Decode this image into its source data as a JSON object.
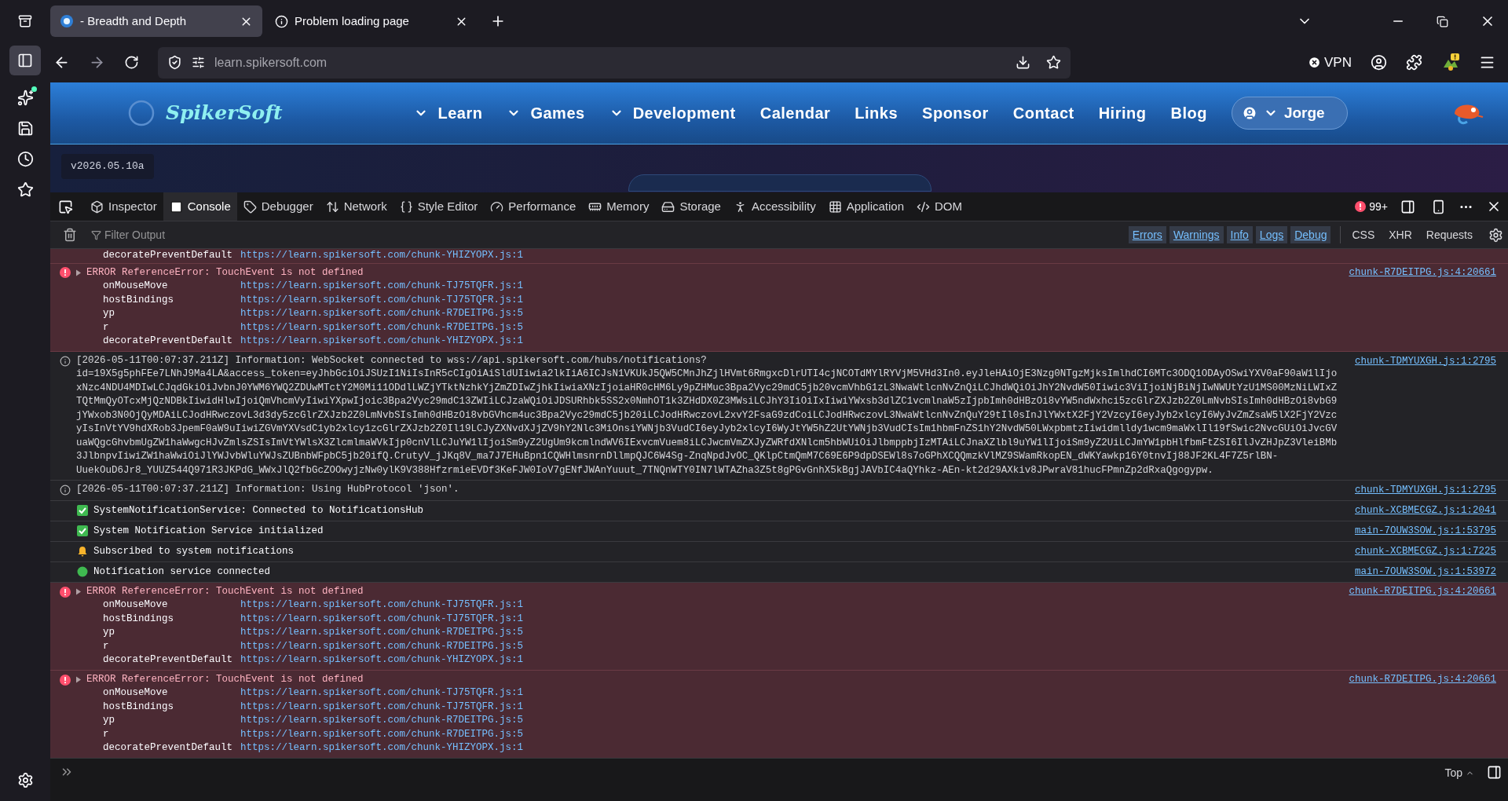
{
  "browser": {
    "tabs": [
      {
        "title": "- Breadth and Depth",
        "selected": true,
        "kind": "site"
      },
      {
        "title": "Problem loading page",
        "selected": false,
        "kind": "info"
      }
    ],
    "url_prefix": "learn.",
    "url_domain": "spikersoft.com",
    "vpn": "VPN"
  },
  "site": {
    "logo": "SpikerSoft",
    "nav": [
      {
        "label": "Learn",
        "dropdown": true
      },
      {
        "label": "Games",
        "dropdown": true
      },
      {
        "label": "Development",
        "dropdown": true
      },
      {
        "label": "Calendar",
        "dropdown": false
      },
      {
        "label": "Links",
        "dropdown": false
      },
      {
        "label": "Sponsor",
        "dropdown": false
      },
      {
        "label": "Contact",
        "dropdown": false
      },
      {
        "label": "Hiring",
        "dropdown": false
      },
      {
        "label": "Blog",
        "dropdown": false
      }
    ],
    "user": "Jorge",
    "version": "v2026.05.10a"
  },
  "devtools": {
    "tabs": [
      {
        "label": "Inspector",
        "selected": false
      },
      {
        "label": "Console",
        "selected": true
      },
      {
        "label": "Debugger",
        "selected": false
      },
      {
        "label": "Network",
        "selected": false
      },
      {
        "label": "Style Editor",
        "selected": false
      },
      {
        "label": "Performance",
        "selected": false
      },
      {
        "label": "Memory",
        "selected": false
      },
      {
        "label": "Storage",
        "selected": false
      },
      {
        "label": "Accessibility",
        "selected": false
      },
      {
        "label": "Application",
        "selected": false
      },
      {
        "label": "DOM",
        "selected": false
      }
    ],
    "error_count": "99+",
    "filter_placeholder": "Filter Output",
    "levels": [
      {
        "label": "Errors",
        "selected": true
      },
      {
        "label": "Warnings",
        "selected": true
      },
      {
        "label": "Info",
        "selected": true
      },
      {
        "label": "Logs",
        "selected": true
      },
      {
        "label": "Debug",
        "selected": true
      }
    ],
    "extras": [
      {
        "label": "CSS",
        "selected": false
      },
      {
        "label": "XHR",
        "selected": false
      },
      {
        "label": "Requests",
        "selected": false
      }
    ],
    "messages": [
      {
        "kind": "frames_tail",
        "frames": [
          {
            "name": "decoratePreventDefault",
            "url": "https://learn.spikersoft.com/chunk-YHIZYOPX.js:1"
          }
        ]
      },
      {
        "kind": "error",
        "text": "ERROR ReferenceError: TouchEvent is not defined",
        "source": "chunk-R7DEITPG.js:4:20661",
        "frames": [
          {
            "name": "onMouseMove",
            "url": "https://learn.spikersoft.com/chunk-TJ75TQFR.js:1"
          },
          {
            "name": "hostBindings",
            "url": "https://learn.spikersoft.com/chunk-TJ75TQFR.js:1"
          },
          {
            "name": "yp",
            "url": "https://learn.spikersoft.com/chunk-R7DEITPG.js:5"
          },
          {
            "name": "r",
            "url": "https://learn.spikersoft.com/chunk-R7DEITPG.js:5"
          },
          {
            "name": "decoratePreventDefault",
            "url": "https://learn.spikersoft.com/chunk-YHIZYOPX.js:1"
          }
        ]
      },
      {
        "kind": "info",
        "text": "[2026-05-11T00:07:37.211Z] Information: WebSocket connected to wss://api.spikersoft.com/hubs/notifications?",
        "source": "chunk-TDMYUXGH.js:1:2795",
        "lines": [
          "id=19X5g5phFEe7LNhJ9Ma4LA&access_token=eyJhbGciOiJSUzI1NiIsInR5cCIgOiAiSldUIiwia2lkIiA6ICJsN1VKUkJ5QW5CMnJhZjlHVmt6RmgxcDlrUTI4cjNCOTdMYlRYVjM5VHd3In0.eyJleHAiOjE3Nzg0NTgzMjksImlhdCI6MTc3ODQ1ODAyOSwiYXV0aF90aW1lIjo",
          "xNzc4NDU4MDIwLCJqdGkiOiJvbnJ0YWM6YWQ2ZDUwMTctY2M0Mi11ODdlLWZjYTktNzhkYjZmZDIwZjhkIiwiaXNzIjoiaHR0cHM6Ly9pZHMuc3Bpa2Vyc29mdC5jb20vcmVhbG1zL3NwaWtlcnNvZnQiLCJhdWQiOiJhY2NvdW50Iiwic3ViIjoiNjBiNjIwNWUtYzU1MS00MzNiLWIxZ",
          "TQtMmQyOTcxMjQzNDBkIiwidHlwIjoiQmVhcmVyIiwiYXpwIjoic3Bpa2Vyc29mdC13ZWIiLCJzaWQiOiJDSURhbk5SS2x0NmhOT1k3ZHdDX0Z3MWsiLCJhY3IiOiIxIiwiYWxsb3dlZC1vcmlnaW5zIjpbImh0dHBzOi8vYW5ndWxhci5zcGlrZXJzb2Z0LmNvbSIsImh0dHBzOi8vbG9",
          "jYWxob3N0OjQyMDAiLCJodHRwczovL3d3dy5zcGlrZXJzb2Z0LmNvbSIsImh0dHBzOi8vbGVhcm4uc3Bpa2Vyc29mdC5jb20iLCJodHRwczovL2xvY2FsaG9zdCoiLCJodHRwczovL3NwaWtlcnNvZnQuY29tIl0sInJlYWxtX2FjY2VzcyI6eyJyb2xlcyI6WyJvZmZsaW5lX2FjY2Vzc",
          "yIsInVtYV9hdXRob3JpemF0aW9uIiwiZGVmYXVsdC1yb2xlcy1zcGlrZXJzb2Z0Il19LCJyZXNvdXJjZV9hY2Nlc3MiOnsiYWNjb3VudCI6eyJyb2xlcyI6WyJtYW5hZ2UtYWNjb3VudCIsIm1hbmFnZS1hY2NvdW50LWxpbmtzIiwidmlldy1wcm9maWxlIl19fSwic2NvcGUiOiJvcGV",
          "uaWQgcGhvbmUgZW1haWwgcHJvZmlsZSIsImVtYWlsX3ZlcmlmaWVkIjp0cnVlLCJuYW1lIjoiSm9yZ2UgUm9kcmlndWV6IExvcmVuem8iLCJwcmVmZXJyZWRfdXNlcm5hbWUiOiJlbmppbjIzMTAiLCJnaXZlbl9uYW1lIjoiSm9yZ2UiLCJmYW1pbHlfbmFtZSI6IlJvZHJpZ3VleiBMb",
          "3JlbnpvIiwiZW1haWwiOiJlYWJvbWluYWJsZUBnbWFpbC5jb20ifQ.CrutyV_jJKq8V_ma7J7EHuBpn1CQWHlmsnrnDllmpQJC6W4Sg-ZnqNpdJvOC_QKlpCtmQmM7C69E6P9dpDSEWl8s7oGPhXCQQmzkVlMZ9SWamRkopEN_dWKYawkp16Y0tnvIj88JF2KL4F7Z5rlBN-",
          "UuekOuD6Jr8_YUUZ544Q971R3JKPdG_WWxJlQ2fbGcZOOwyjzNw0ylK9V388HfzrmieEVDf3KeFJW0IoV7gENfJWAnYuuut_7TNQnWTY0IN7lWTAZha3Z5t8gPGvGnhX5kBgjJAVbIC4aQYhkz-AEn-kt2d29AXkiv8JPwraV81hucFPmnZp2dRxaQgogypw."
        ]
      },
      {
        "kind": "info",
        "text": "[2026-05-11T00:07:37.211Z] Information: Using HubProtocol 'json'.",
        "source": "chunk-TDMYUXGH.js:1:2795"
      },
      {
        "kind": "success",
        "text": "SystemNotificationService: Connected to NotificationsHub",
        "source": "chunk-XCBMECGZ.js:1:2041"
      },
      {
        "kind": "success",
        "text": "System Notification Service initialized",
        "source": "main-7OUW3SOW.js:1:53795"
      },
      {
        "kind": "notice",
        "text": "Subscribed to system notifications",
        "source": "chunk-XCBMECGZ.js:1:7225"
      },
      {
        "kind": "status",
        "text": "Notification service connected",
        "source": "main-7OUW3SOW.js:1:53972"
      },
      {
        "kind": "error",
        "text": "ERROR ReferenceError: TouchEvent is not defined",
        "source": "chunk-R7DEITPG.js:4:20661",
        "frames": [
          {
            "name": "onMouseMove",
            "url": "https://learn.spikersoft.com/chunk-TJ75TQFR.js:1"
          },
          {
            "name": "hostBindings",
            "url": "https://learn.spikersoft.com/chunk-TJ75TQFR.js:1"
          },
          {
            "name": "yp",
            "url": "https://learn.spikersoft.com/chunk-R7DEITPG.js:5"
          },
          {
            "name": "r",
            "url": "https://learn.spikersoft.com/chunk-R7DEITPG.js:5"
          },
          {
            "name": "decoratePreventDefault",
            "url": "https://learn.spikersoft.com/chunk-YHIZYOPX.js:1"
          }
        ]
      },
      {
        "kind": "error",
        "text": "ERROR ReferenceError: TouchEvent is not defined",
        "source": "chunk-R7DEITPG.js:4:20661",
        "frames": [
          {
            "name": "onMouseMove",
            "url": "https://learn.spikersoft.com/chunk-TJ75TQFR.js:1"
          },
          {
            "name": "hostBindings",
            "url": "https://learn.spikersoft.com/chunk-TJ75TQFR.js:1"
          },
          {
            "name": "yp",
            "url": "https://learn.spikersoft.com/chunk-R7DEITPG.js:5"
          },
          {
            "name": "r",
            "url": "https://learn.spikersoft.com/chunk-R7DEITPG.js:5"
          },
          {
            "name": "decoratePreventDefault",
            "url": "https://learn.spikersoft.com/chunk-YHIZYOPX.js:1"
          }
        ]
      }
    ],
    "input_context": "Top"
  }
}
